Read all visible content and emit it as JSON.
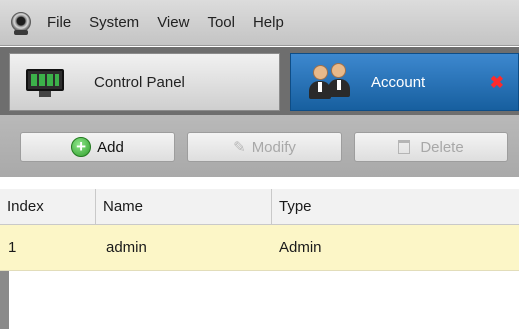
{
  "menubar": {
    "items": [
      "File",
      "System",
      "View",
      "Tool",
      "Help"
    ]
  },
  "tabs": [
    {
      "label": "Control Panel",
      "icon": "monitor-icon",
      "active": false
    },
    {
      "label": "Account",
      "icon": "users-icon",
      "active": true,
      "close_glyph": "✖"
    }
  ],
  "toolbar": {
    "add_label": "Add",
    "modify_label": "Modify",
    "delete_label": "Delete"
  },
  "table": {
    "columns": [
      "Index",
      "Name",
      "Type"
    ],
    "rows": [
      {
        "index": "1",
        "name": "admin",
        "type": "Admin"
      }
    ]
  },
  "colors": {
    "active_tab": "#2a76bd",
    "selected_row": "#fcf6c7",
    "close_icon": "#ff2a2a",
    "add_icon": "#2f9e2b"
  }
}
